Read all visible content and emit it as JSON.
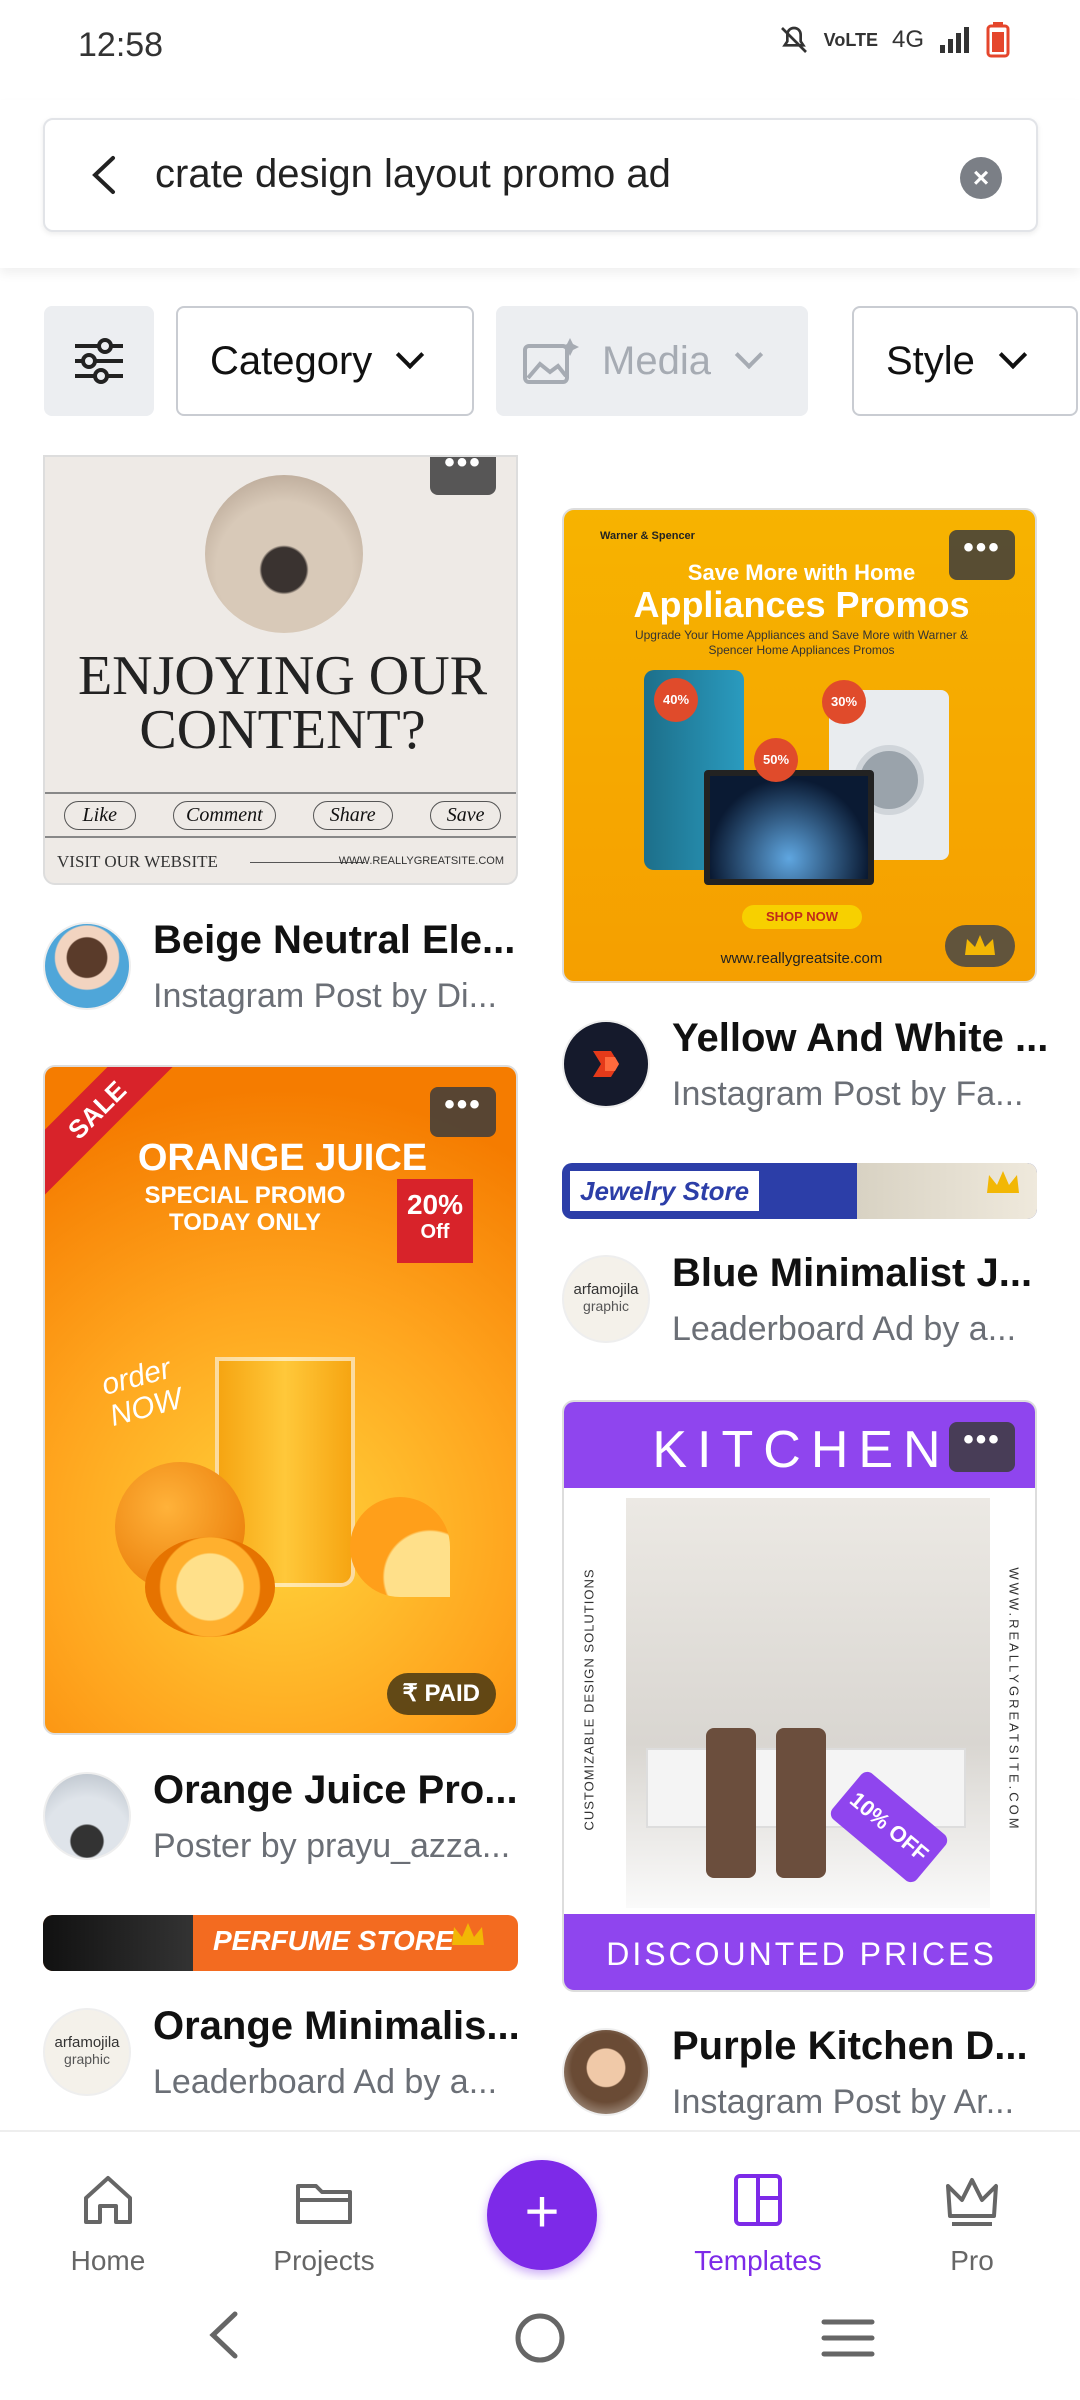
{
  "status": {
    "time": "12:58",
    "network": "4G"
  },
  "search": {
    "query": "crate design layout promo ad"
  },
  "filters": {
    "category": "Category",
    "media": "Media",
    "style": "Style"
  },
  "cards": {
    "beige": {
      "headline": "ENJOYING OUR CONTENT?",
      "actions": [
        "Like",
        "Comment",
        "Share",
        "Save"
      ],
      "footer_left": "VISIT OUR WEBSITE",
      "footer_right": "WWW.REALLYGREATSITE.COM"
    },
    "appliances": {
      "brand": "Warner & Spencer",
      "line1": "Save More with Home",
      "line2": "Appliances Promos",
      "blurb": "Upgrade Your Home Appliances and Save More with Warner & Spencer Home Appliances Promos",
      "badge1": "40%",
      "badge2": "30%",
      "badge3": "50%",
      "shop": "SHOP NOW",
      "site": "www.reallygreatsite.com"
    },
    "jewelry": {
      "label": "Jewelry Store"
    },
    "orange": {
      "sale": "SALE",
      "title": "ORANGE JUICE",
      "sub1": "SPECIAL PROMO",
      "sub2": "TODAY ONLY",
      "discount": "20%",
      "off": "Off",
      "order": "order NOW",
      "paid": "₹ PAID"
    },
    "kitchen": {
      "title": "KITCHEN",
      "side_left": "CUSTOMIZABLE DESIGN SOLUTIONS",
      "side_right": "WWW.REALLYGREATSITE.COM",
      "tag": "10% OFF",
      "footer": "DISCOUNTED PRICES"
    },
    "perfume": {
      "label": "PERFUME STORE"
    }
  },
  "meta": {
    "beige": {
      "title": "Beige Neutral Ele...",
      "sub": "Instagram Post by Di..."
    },
    "yellow": {
      "title": "Yellow And White ...",
      "sub": "Instagram Post by Fa..."
    },
    "blue": {
      "title": "Blue Minimalist J...",
      "sub": "Leaderboard Ad by a..."
    },
    "orange": {
      "title": "Orange Juice Pro...",
      "sub": "Poster by prayu_azza..."
    },
    "purple": {
      "title": "Purple Kitchen D...",
      "sub": "Instagram Post by Ar..."
    },
    "orange_min": {
      "title": "Orange Minimalis...",
      "sub": "Leaderboard Ad by a..."
    }
  },
  "avatar_logo": {
    "line1": "arfamojila",
    "line2": "graphic"
  },
  "nav": {
    "home": "Home",
    "projects": "Projects",
    "templates": "Templates",
    "pro": "Pro"
  },
  "colors": {
    "accent": "#7d2ae8",
    "orange": "#f57c00",
    "yellow": "#f7b300"
  }
}
